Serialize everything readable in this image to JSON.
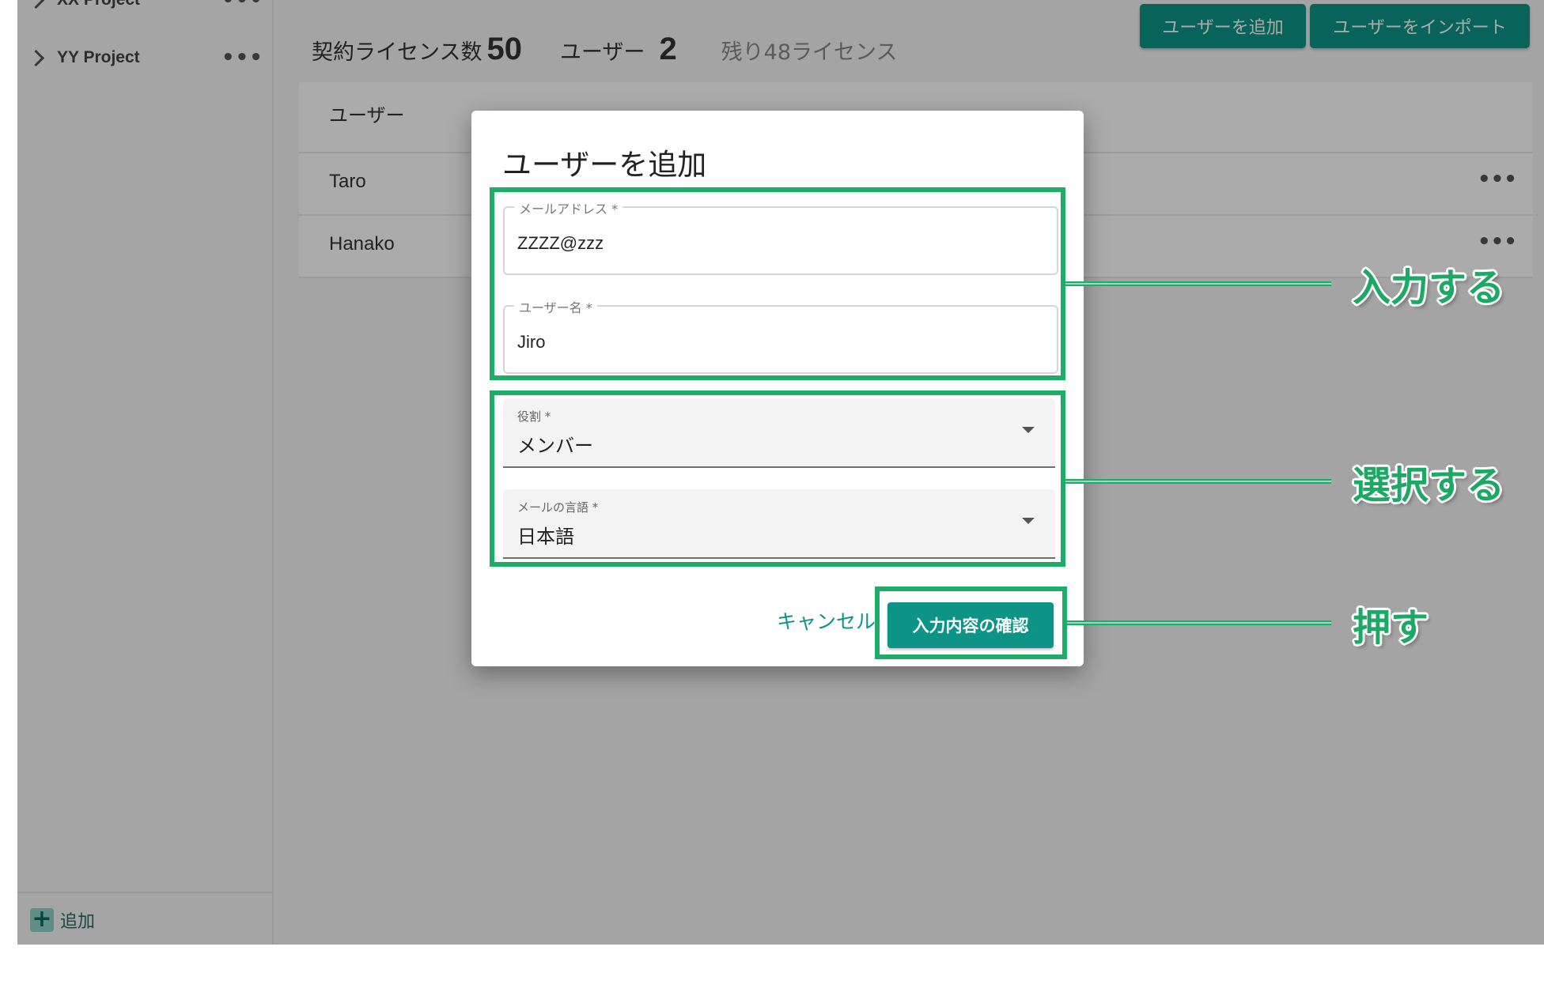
{
  "sidebar": {
    "projects": [
      {
        "name": "XX Project",
        "more": "•••"
      },
      {
        "name": "YY Project",
        "more": "•••"
      }
    ],
    "add_label": "追加"
  },
  "header": {
    "license_label": "契約ライセンス数",
    "license_count": "50",
    "users_label": "ユーザー",
    "users_count": "2",
    "remaining": "残り48ライセンス",
    "add_user_button": "ユーザーを追加",
    "import_user_button": "ユーザーをインポート"
  },
  "table": {
    "header_user": "ユーザー",
    "rows": [
      {
        "name": "Taro",
        "more": "•••"
      },
      {
        "name": "Hanako",
        "more": "•••"
      }
    ]
  },
  "dialog": {
    "title": "ユーザーを追加",
    "email": {
      "label": "メールアドレス *",
      "value": "ZZZZ@zzz"
    },
    "username": {
      "label": "ユーザー名 *",
      "value": "Jiro"
    },
    "role": {
      "label": "役割 *",
      "value": "メンバー"
    },
    "mail_language": {
      "label": "メールの言語 *",
      "value": "日本語"
    },
    "cancel_label": "キャンセル",
    "confirm_label": "入力内容の確認"
  },
  "annotations": {
    "input": "入力する",
    "select": "選択する",
    "press": "押す",
    "color": "#1fab69"
  },
  "colors": {
    "accent": "#0d9487",
    "highlight": "#1fab69"
  }
}
